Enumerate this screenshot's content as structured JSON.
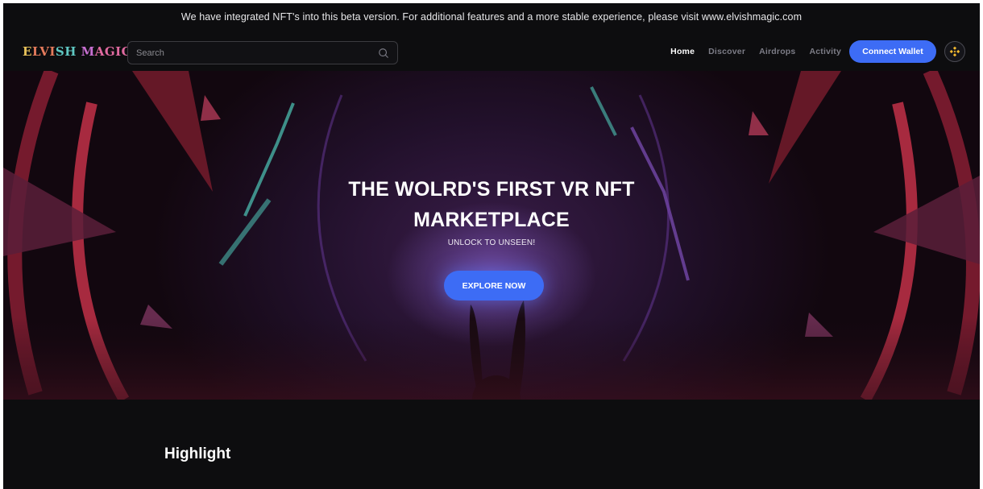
{
  "announcement": "We have integrated NFT's into this beta version. For additional features and a more stable experience, please visit www.elvishmagic.com",
  "brand": {
    "logo_text": "Elvish Magic",
    "colors": {
      "gold": "#e8c25a",
      "orange": "#e57b5c",
      "purple": "#c76fd1",
      "teal": "#5fc7c2",
      "pink": "#e06aa0"
    }
  },
  "search": {
    "placeholder": "Search",
    "icon": "search-icon"
  },
  "nav": {
    "items": [
      {
        "label": "Home",
        "active": true
      },
      {
        "label": "Discover",
        "active": false
      },
      {
        "label": "Airdrops",
        "active": false
      },
      {
        "label": "Activity",
        "active": false
      }
    ],
    "connect_label": "Connect Wallet",
    "network_icon": "binance-icon"
  },
  "hero": {
    "title": "THE WOLRD'S FIRST VR NFT MARKETPLACE",
    "subtitle": "UNLOCK TO UNSEEN!",
    "cta_label": "EXPLORE NOW"
  },
  "section": {
    "title": "Highlight"
  },
  "colors": {
    "accent": "#3d6cf5",
    "background": "#0d0d0f",
    "binance": "#f3ba2f"
  }
}
